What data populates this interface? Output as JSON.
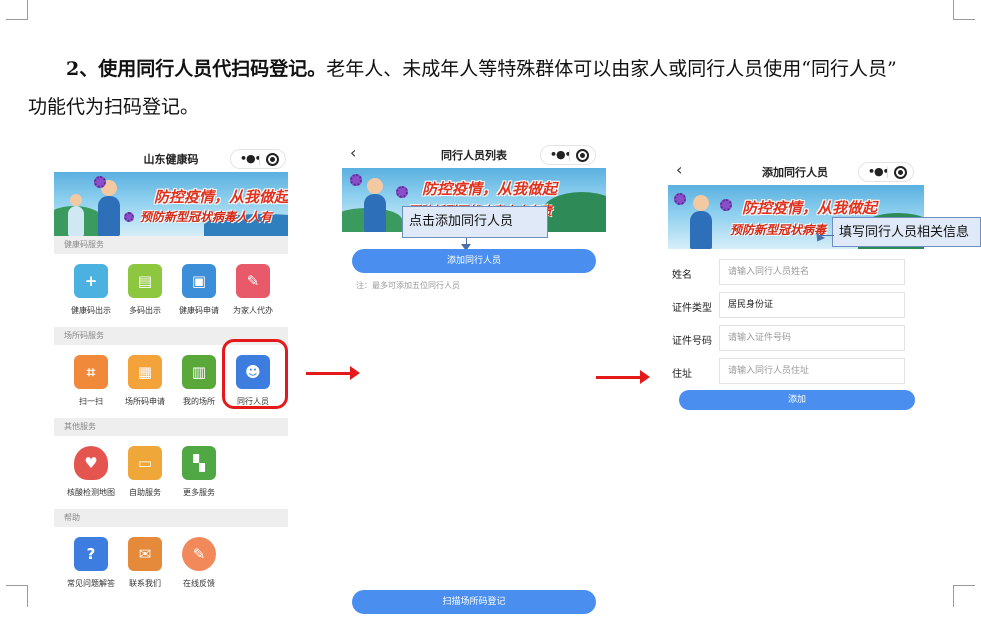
{
  "paragraph": {
    "lead": "2、使用同行人员代扫码登记。",
    "line1_rest": "老年人、未成年人等特殊群体可以由家人或同行人员使用“同行人员”",
    "line2": "功能代为扫码登记。"
  },
  "screen1": {
    "title": "山东健康码",
    "banner": {
      "line1": "防控疫情，从我做起",
      "line2": "预防新型冠状病毒人人有"
    },
    "sections": [
      {
        "header": "健康码服务",
        "items": [
          {
            "label": "健康码出示",
            "icon": "add-card-icon",
            "color": "#4bb1e0"
          },
          {
            "label": "多码出示",
            "icon": "multi-code-icon",
            "color": "#8dc63f"
          },
          {
            "label": "健康码申请",
            "icon": "id-card-icon",
            "color": "#3d8ed8"
          },
          {
            "label": "为家人代办",
            "icon": "family-icon",
            "color": "#e85a6a"
          }
        ]
      },
      {
        "header": "场所码服务",
        "items": [
          {
            "label": "扫一扫",
            "icon": "scan-icon",
            "color": "#f08a3a"
          },
          {
            "label": "场所码申请",
            "icon": "qr-code-icon",
            "color": "#f4a23a"
          },
          {
            "label": "我的场所",
            "icon": "building-icon",
            "color": "#5aa83a"
          },
          {
            "label": "同行人员",
            "icon": "companions-icon",
            "color": "#3d7de0"
          }
        ]
      },
      {
        "header": "其他服务",
        "items": [
          {
            "label": "核酸检测地图",
            "icon": "dna-heart-icon",
            "color": "#e5554f"
          },
          {
            "label": "自助服务",
            "icon": "self-service-icon",
            "color": "#f0a73a"
          },
          {
            "label": "更多服务",
            "icon": "grid-icon",
            "color": "#4fa844"
          }
        ]
      },
      {
        "header": "帮助",
        "items": [
          {
            "label": "常见问题解答",
            "icon": "faq-icon",
            "color": "#3d7de0"
          },
          {
            "label": "联系我们",
            "icon": "contact-icon",
            "color": "#e58a3a"
          },
          {
            "label": "在线反馈",
            "icon": "feedback-icon",
            "color": "#f2895a"
          }
        ]
      }
    ]
  },
  "screen2": {
    "title": "同行人员列表",
    "banner": {
      "line1": "防控疫情，从我做起",
      "line2": "预防新型冠状病毒人人有责"
    },
    "callout": "点击添加同行人员",
    "add_button": "添加同行人员",
    "note": "注：最多可添加五位同行人员",
    "scan_button": "扫描场所码登记"
  },
  "screen3": {
    "title": "添加同行人员",
    "banner": {
      "line1": "防控疫情，从我做起",
      "line2": "预防新型冠状病毒"
    },
    "callout": "填写同行人员相关信息",
    "fields": [
      {
        "label": "姓名",
        "placeholder": "请输入同行人员姓名",
        "value": ""
      },
      {
        "label": "证件类型",
        "placeholder": "",
        "value": "居民身份证"
      },
      {
        "label": "证件号码",
        "placeholder": "请输入证件号码",
        "value": ""
      },
      {
        "label": "住址",
        "placeholder": "请输入同行人员住址",
        "value": ""
      }
    ],
    "submit_button": "添加"
  },
  "colors": {
    "accent": "#4a8ff0",
    "highlight": "#e41a1a",
    "callout_bg": "#dfe9f7"
  }
}
